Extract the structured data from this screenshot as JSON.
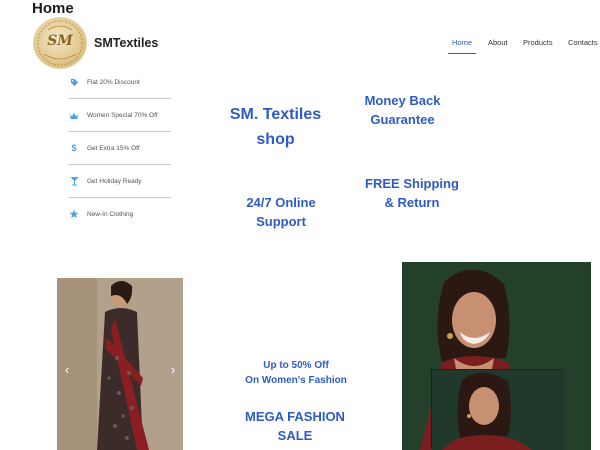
{
  "page": {
    "heading": "Home"
  },
  "header": {
    "brand": "SMTextiles",
    "logo_monogram": "SM",
    "nav": [
      {
        "label": "Home",
        "active": true
      },
      {
        "label": "About",
        "active": false
      },
      {
        "label": "Products",
        "active": false
      },
      {
        "label": "Contacts",
        "active": false
      }
    ]
  },
  "side_menu": [
    {
      "label": "Flat 20% Discount",
      "icon": "tag-icon"
    },
    {
      "label": "Women Special 70% Off",
      "icon": "crown-icon"
    },
    {
      "label": "Get Extra 15% Off",
      "icon": "dollar-icon"
    },
    {
      "label": "Get Holiday Ready",
      "icon": "cocktail-icon"
    },
    {
      "label": "New-In Clothing",
      "icon": "star-icon"
    }
  ],
  "promos": {
    "shop_title_line1": "SM. Textiles",
    "shop_title_line2": "shop",
    "money_back_line1": "Money Back",
    "money_back_line2": "Guarantee",
    "support_line1": "24/7 Online",
    "support_line2": "Support",
    "shipping_line1": "FREE Shipping",
    "shipping_line2": "& Return"
  },
  "sale": {
    "offer_line1": "Up to 50% Off",
    "offer_line2": "On Women's Fashion",
    "mega_line1": "MEGA FASHION",
    "mega_line2": "SALE"
  },
  "carousel": {
    "prev_symbol": "‹",
    "next_symbol": "›"
  },
  "colors": {
    "accent": "#2d5cc4",
    "icon": "#4aa3e0",
    "nav_active": "#2f5fb8"
  }
}
